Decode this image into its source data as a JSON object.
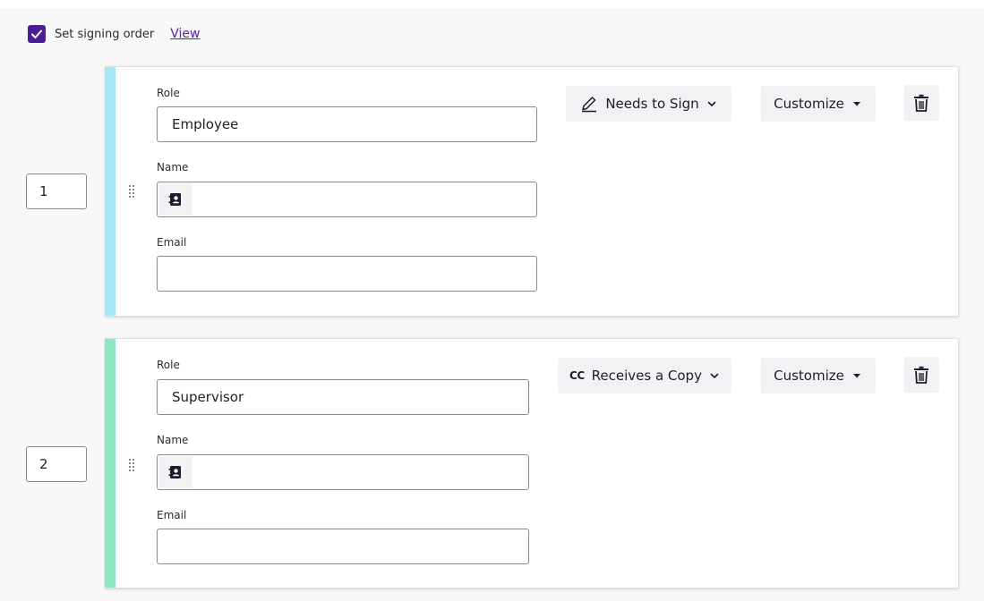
{
  "signing": {
    "checkbox_checked": true,
    "label": "Set signing order",
    "view_link": "View"
  },
  "colors": {
    "accent": "#4c1d95",
    "stripe_1": "#a5e9f7",
    "stripe_2": "#8de8bf"
  },
  "recipients": [
    {
      "order": "1",
      "role_label": "Role",
      "role_value": "Employee",
      "name_label": "Name",
      "name_value": "",
      "email_label": "Email",
      "email_value": "",
      "action_label": "Needs to Sign",
      "action_icon": "pen-icon",
      "customize_label": "Customize"
    },
    {
      "order": "2",
      "role_label": "Role",
      "role_value": "Supervisor",
      "name_label": "Name",
      "name_value": "",
      "email_label": "Email",
      "email_value": "",
      "action_label": "Receives a Copy",
      "action_icon": "CC",
      "customize_label": "Customize"
    }
  ]
}
